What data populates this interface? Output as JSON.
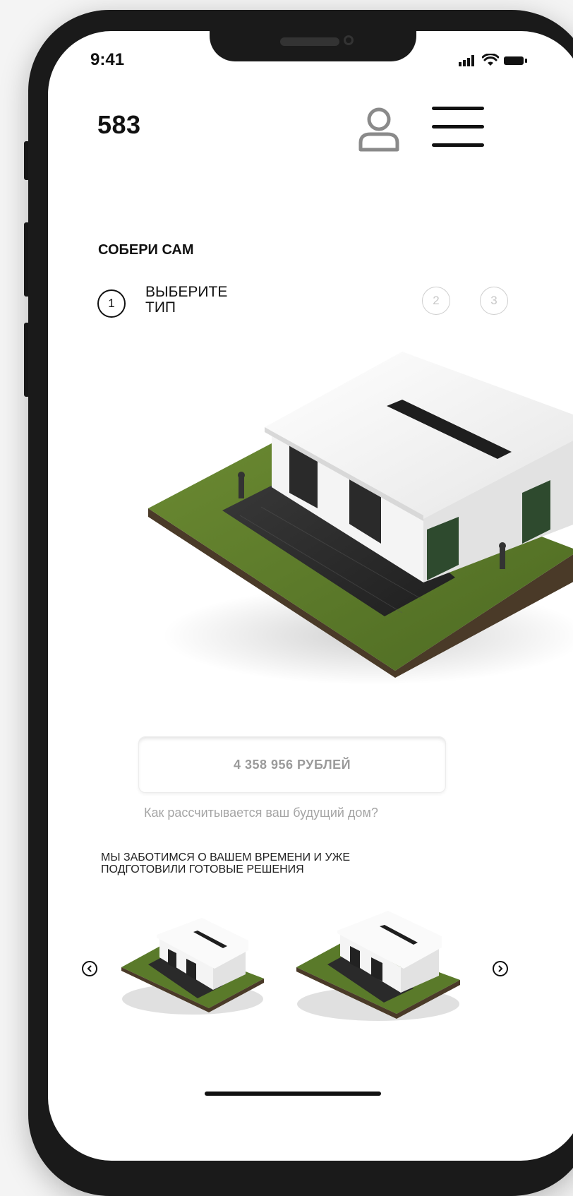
{
  "status_bar": {
    "time": "9:41",
    "icons": [
      "signal-icon",
      "wifi-icon",
      "battery-icon"
    ]
  },
  "header": {
    "brand": "583",
    "user_icon": "user-icon",
    "menu_icon": "hamburger-menu-icon"
  },
  "builder": {
    "title": "СОБЕРИ САМ",
    "steps": [
      {
        "number": "1",
        "label": "ВЫБЕРИТЕ\nТИП",
        "active": true
      },
      {
        "number": "2",
        "active": false
      },
      {
        "number": "3",
        "active": false
      }
    ]
  },
  "price": {
    "value": "4 358 956 РУБЛЕЙ",
    "calc_link": "Как рассчитывается ваш будущий дом?"
  },
  "ready_solutions": {
    "text": "МЫ ЗАБОТИМСЯ О ВАШЕМ ВРЕМЕНИ И УЖЕ ПОДГОТОВИЛИ ГОТОВЫЕ РЕШЕНИЯ",
    "prev_icon": "chevron-left-icon",
    "next_icon": "chevron-right-icon"
  },
  "colors": {
    "text": "#111111",
    "muted": "#a5a5a5",
    "grass": "#5a7a2a",
    "soil": "#4a3a28",
    "wall": "#f2f2f2",
    "glass": "#2a2a2a"
  }
}
